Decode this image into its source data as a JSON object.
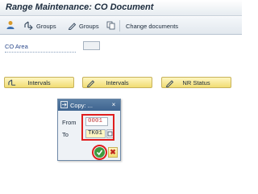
{
  "window": {
    "title": "Range Maintenance: CO Document"
  },
  "toolbar": {
    "groups_label": "Groups",
    "groups2_label": "Groups",
    "change_docs_label": "Change documents"
  },
  "form": {
    "co_area_label": "CO Area",
    "co_area_value": ""
  },
  "buttons": {
    "intervals_label": "Intervals",
    "intervals2_label": "Intervals",
    "nr_status_label": "NR Status"
  },
  "dialog": {
    "title": "Copy: ...",
    "from_label": "From",
    "from_value": "0001",
    "to_label": "To",
    "to_value": "TK01",
    "close_icon": "×"
  },
  "colors": {
    "accent_button": "#f1dd72",
    "highlight_box": "#e01e1e",
    "ok": "#3e9b3e",
    "dialog_title": "#4a7099"
  }
}
